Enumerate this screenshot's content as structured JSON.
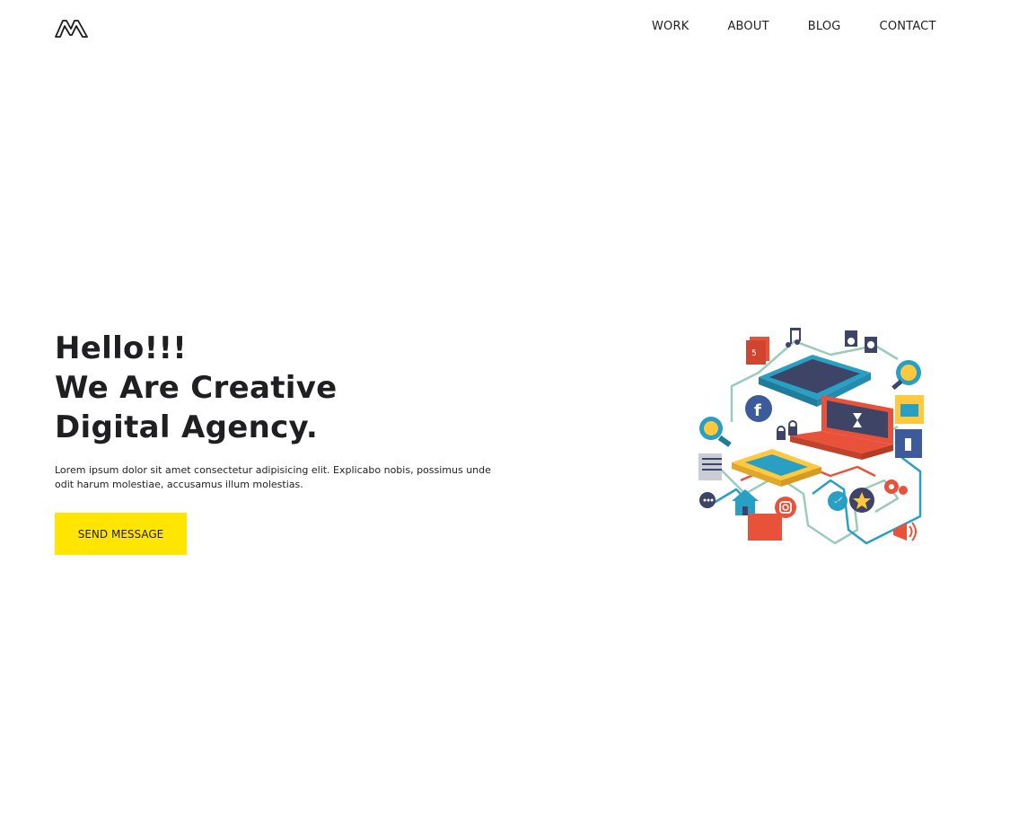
{
  "brand": {
    "logo_icon": "m-logo-icon"
  },
  "nav": {
    "items": [
      {
        "label": "WORK"
      },
      {
        "label": "ABOUT"
      },
      {
        "label": "BLOG"
      },
      {
        "label": "CONTACT"
      }
    ]
  },
  "hero": {
    "title_lines": [
      "Hello!!!",
      "We Are Creative",
      "Digital Agency."
    ],
    "text": "Lorem ipsum dolor sit amet consectetur adipisicing elit. Explicabo nobis, possimus unde odit harum molestiae, accusamus illum molestias.",
    "cta_label": "SEND MESSAGE",
    "cta_color": "#ffe500"
  },
  "illustration": {
    "icons": [
      "html5-icon",
      "music-note-icon",
      "download-icon",
      "tablet-icon",
      "search-plus-icon",
      "facebook-icon",
      "laptop-icon",
      "hourglass-icon",
      "email-icon",
      "search-minus-icon",
      "lock-icon",
      "thumbs-up-icon",
      "document-icon",
      "phone-icon",
      "chat-icon",
      "home-icon",
      "instagram-icon",
      "twitter-icon",
      "star-icon",
      "gear-icon",
      "megaphone-icon"
    ],
    "colors": {
      "red": "#e8523a",
      "teal": "#2a9fc4",
      "navy": "#3d4466",
      "yellow": "#ffc83d",
      "mint": "#9ccbb9",
      "grey": "#8a8f99"
    }
  }
}
